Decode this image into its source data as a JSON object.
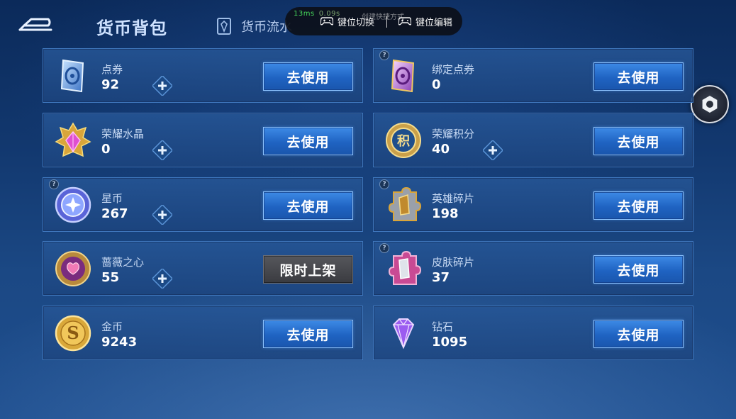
{
  "header": {
    "title": "货币背包",
    "flow_tab_label": "货币流水",
    "back_icon": "back-arrow-icon"
  },
  "overlay": {
    "latency": "13ms",
    "fps_text": "0.09s",
    "faint_text": "创建快捷方式",
    "switch_label": "键位切换",
    "edit_label": "键位编辑"
  },
  "currencies": [
    {
      "name": "点券",
      "amount": "92",
      "button": "去使用",
      "icon": "coupon-card-icon"
    },
    {
      "name": "绑定点券",
      "amount": "0",
      "button": "去使用",
      "icon": "bound-coupon-card-icon"
    },
    {
      "name": "荣耀水晶",
      "amount": "0",
      "button": "去使用",
      "icon": "glory-crystal-icon"
    },
    {
      "name": "荣耀积分",
      "amount": "40",
      "button": "去使用",
      "icon": "glory-points-icon"
    },
    {
      "name": "星币",
      "amount": "267",
      "button": "去使用",
      "icon": "star-coin-icon"
    },
    {
      "name": "英雄碎片",
      "amount": "198",
      "button": "去使用",
      "icon": "hero-fragment-icon"
    },
    {
      "name": "蔷薇之心",
      "amount": "55",
      "button": "限时上架",
      "icon": "rose-heart-icon"
    },
    {
      "name": "皮肤碎片",
      "amount": "37",
      "button": "去使用",
      "icon": "skin-fragment-icon"
    },
    {
      "name": "金币",
      "amount": "9243",
      "button": "去使用",
      "icon": "gold-coin-icon"
    },
    {
      "name": "钻石",
      "amount": "1095",
      "button": "去使用",
      "icon": "diamond-icon"
    }
  ],
  "help_mark": "?",
  "colors": {
    "accent": "#3d8ae6",
    "card_bg": "#26569a",
    "disabled_btn": "#4a4b50"
  }
}
